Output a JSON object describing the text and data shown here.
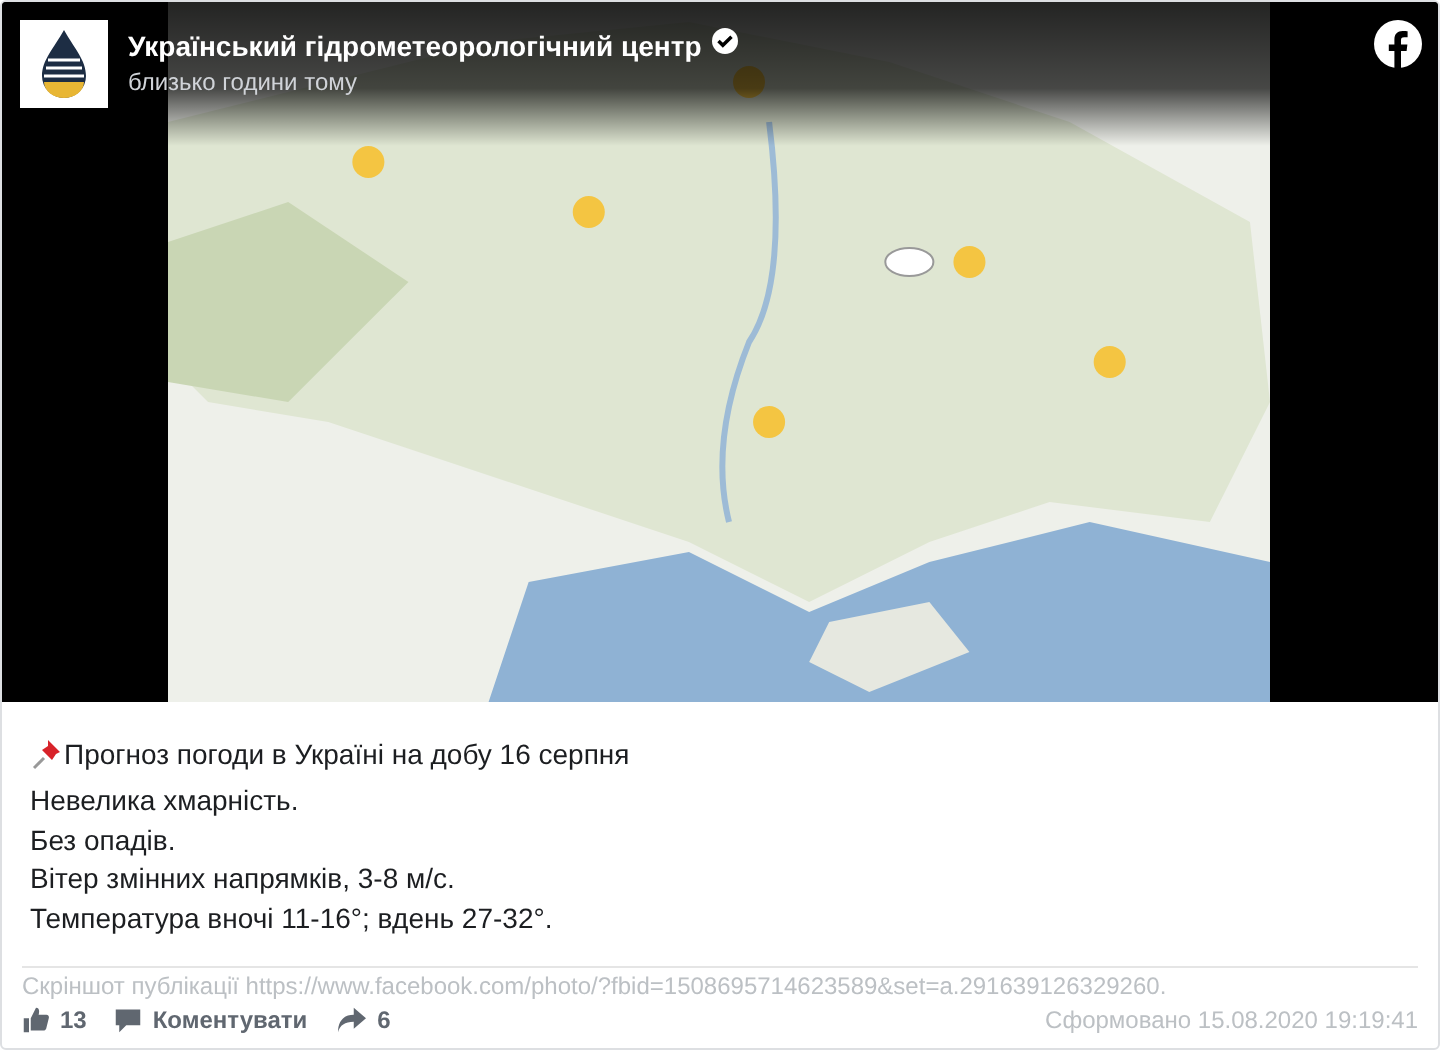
{
  "post": {
    "author": "Український гідрометеорологічний центр",
    "verified": true,
    "time": "близько години тому",
    "title": "Прогноз погоди в Україні на добу 16 серпня",
    "lines": [
      "Невелика хмарність.",
      "Без опадів.",
      "Вітер змінних напрямків, 3-8 м/с.",
      "Температура вночі 11-16°; вдень 27-32°."
    ]
  },
  "caption": {
    "source": "Скріншот публікації https://www.facebook.com/photo/?fbid=1508695714623589&set=a.291639126329260.",
    "generated": "Сформовано 15.08.2020 19:19:41"
  },
  "actions": [
    {
      "kind": "like",
      "label": "13"
    },
    {
      "kind": "comment",
      "label": "Коментувати"
    },
    {
      "kind": "share",
      "label": "6"
    }
  ]
}
